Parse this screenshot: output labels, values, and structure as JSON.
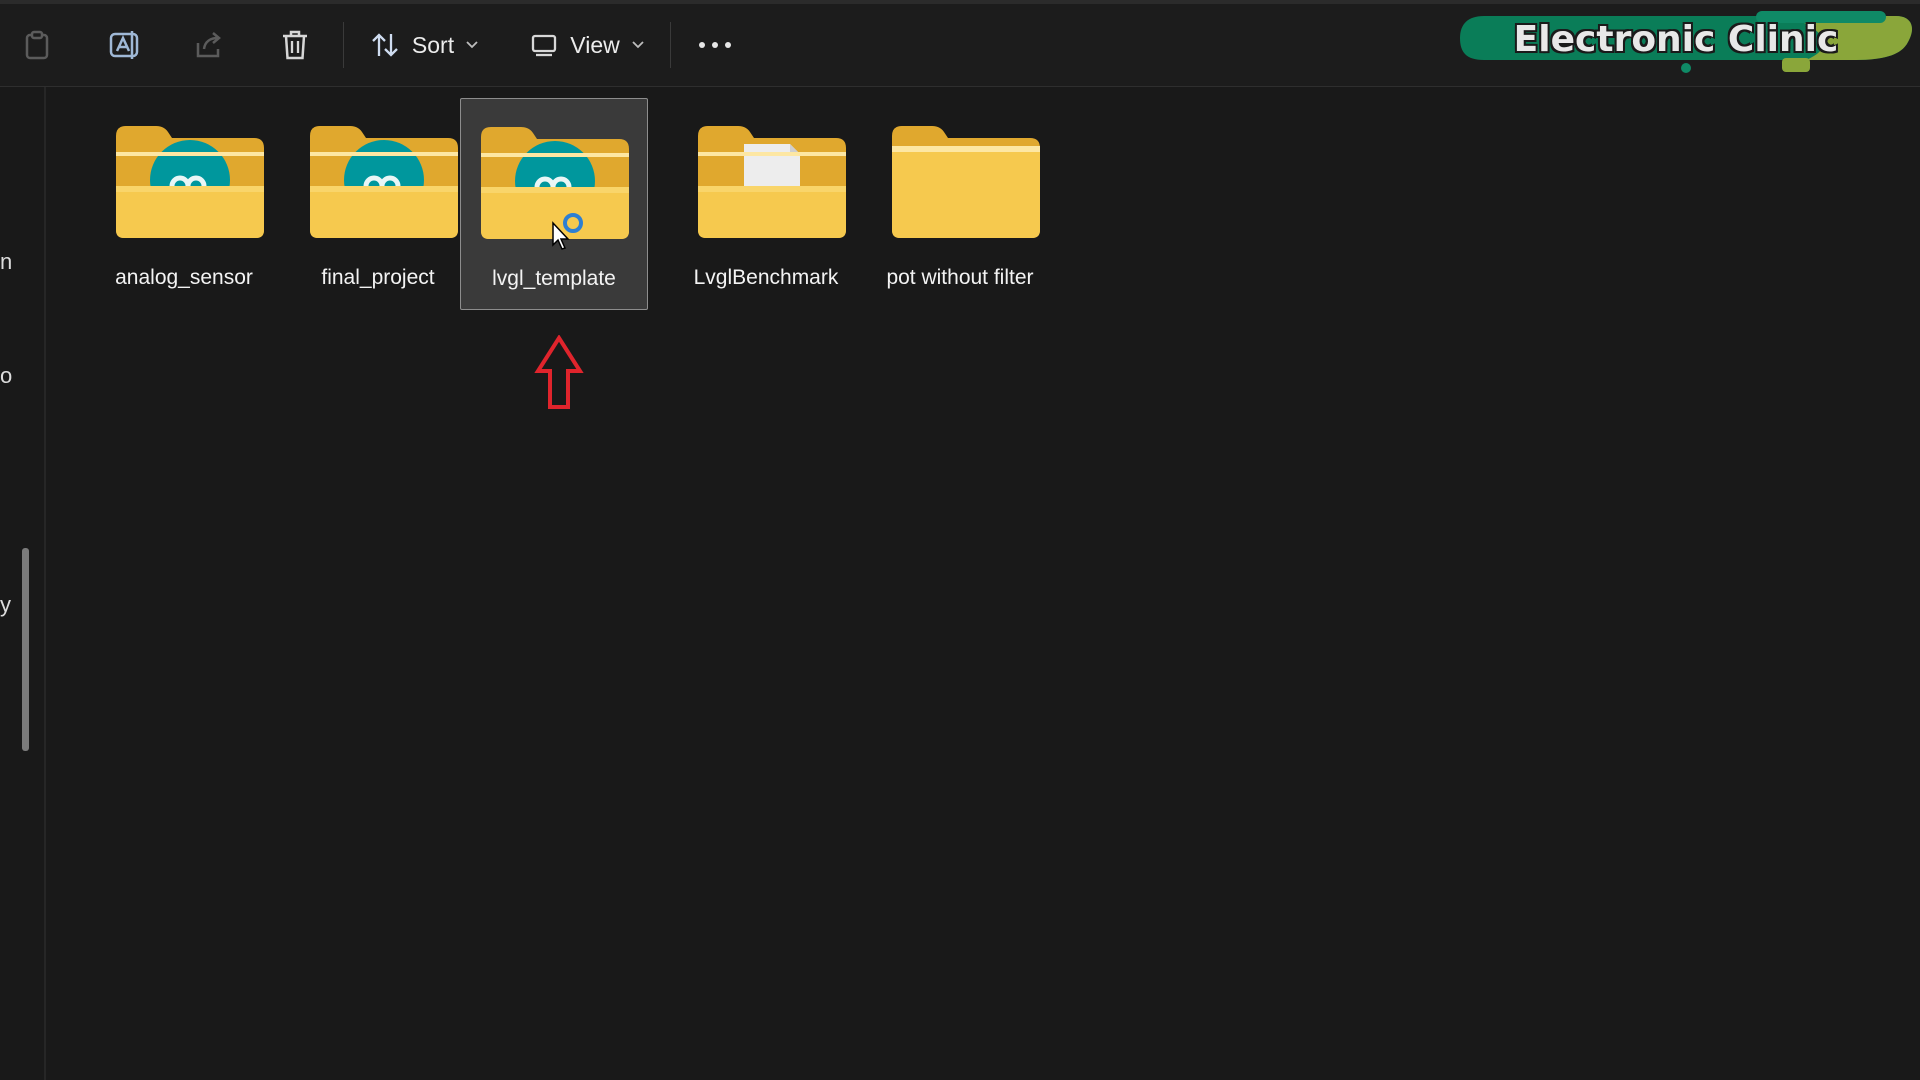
{
  "toolbar": {
    "sort_label": "Sort",
    "view_label": "View",
    "icons": [
      "copy-icon",
      "rename-icon",
      "share-icon",
      "delete-icon",
      "sort-icon",
      "view-icon",
      "more-icon"
    ]
  },
  "sidebar": {
    "fragments": [
      "n",
      "o",
      "y"
    ]
  },
  "files": [
    {
      "name": "analog_sensor",
      "icon": "arduino-folder-icon",
      "selected": false
    },
    {
      "name": "final_project",
      "icon": "arduino-folder-icon",
      "selected": false
    },
    {
      "name": "lvgl_template",
      "icon": "arduino-folder-icon",
      "selected": true
    },
    {
      "name": "LvglBenchmark",
      "icon": "document-folder-icon",
      "selected": false
    },
    {
      "name": "pot without filter",
      "icon": "empty-folder-icon",
      "selected": false
    }
  ],
  "watermark": {
    "text": "Electronic Clinic"
  },
  "colors": {
    "background": "#191919",
    "folder": "#f3c64a",
    "arduino_teal": "#00979d",
    "annotation_arrow": "#e0242c",
    "watermark_green": "#0a7d58"
  }
}
